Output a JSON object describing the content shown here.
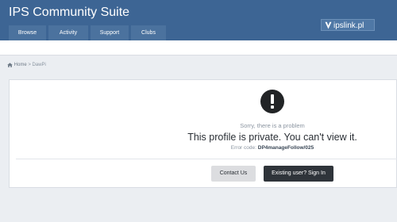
{
  "header": {
    "site_title": "IPS Community Suite",
    "nav": [
      "Browse",
      "Activity",
      "Support",
      "Clubs"
    ],
    "brand_badge": "ipslink.pl",
    "background_color": "#3d6594"
  },
  "breadcrumb": {
    "home_icon": "home-icon",
    "home_label": "Home",
    "separator": ">",
    "current": "DawPi"
  },
  "error": {
    "icon": "exclamation-circle-icon",
    "sorry_text": "Sorry, there is a problem",
    "message": "This profile is private. You can't view it.",
    "code_label": "Error code:",
    "code_value": "DP4manageFollow/025"
  },
  "actions": {
    "contact_label": "Contact Us",
    "signin_label": "Existing user? Sign In"
  }
}
